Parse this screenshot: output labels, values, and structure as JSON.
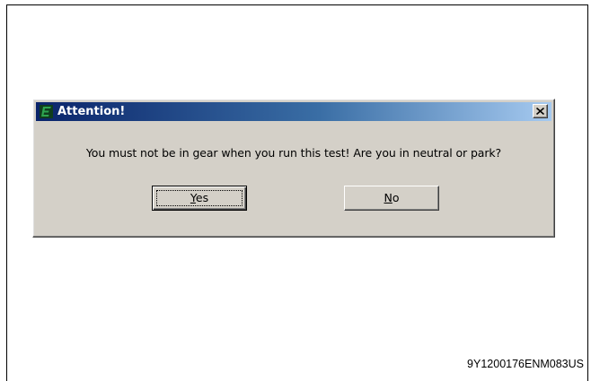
{
  "dialog": {
    "title": "Attention!",
    "icon": "app-logo-icon",
    "close_icon": "close-icon",
    "message": "You must not be in gear when you run this test!  Are you in neutral or park?",
    "buttons": {
      "yes": {
        "mnemonic": "Y",
        "rest": "es"
      },
      "no": {
        "mnemonic": "N",
        "rest": "o"
      }
    }
  },
  "colors": {
    "titlebar_start": "#0a246a",
    "titlebar_end": "#a6caf0",
    "dialog_face": "#d4d0c8",
    "icon_green": "#2ea44f"
  },
  "figure": {
    "caption": "9Y1200176ENM083US"
  }
}
